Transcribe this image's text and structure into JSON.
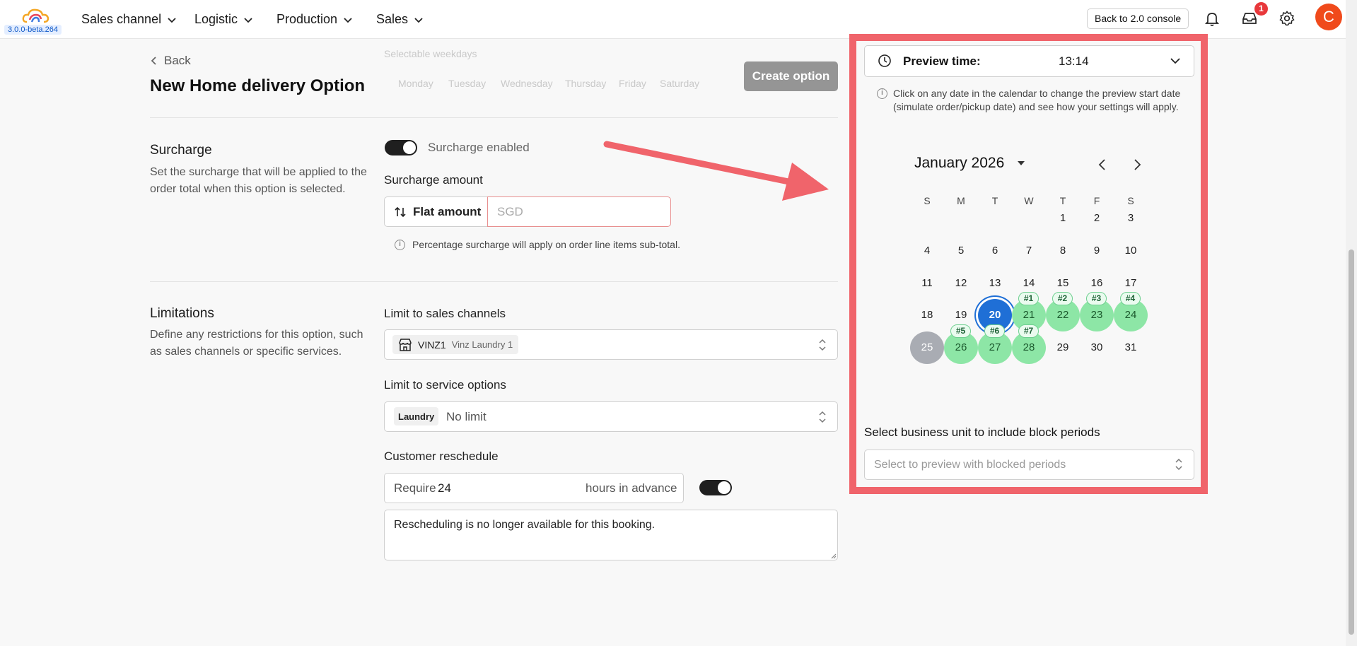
{
  "app": {
    "version": "3.0.0-beta.264",
    "back_console_label": "Back to 2.0 console",
    "notification_count": "1",
    "avatar_initial": "C"
  },
  "nav": {
    "items": [
      {
        "label": "Sales channel"
      },
      {
        "label": "Logistic"
      },
      {
        "label": "Production"
      },
      {
        "label": "Sales"
      }
    ]
  },
  "header": {
    "back_label": "Back",
    "title": "New Home delivery Option",
    "create_label": "Create option"
  },
  "ghost": {
    "selectable_weekdays": "Selectable weekdays",
    "weekdays": [
      "Monday",
      "Tuesday",
      "Wednesday",
      "Thursday",
      "Friday",
      "Saturday"
    ]
  },
  "surcharge": {
    "title": "Surcharge",
    "description": "Set the surcharge that will be applied to the order total when this option is selected.",
    "toggle_label": "Surcharge enabled",
    "toggle_on": true,
    "amount_label": "Surcharge amount",
    "type_label": "Flat amount",
    "amount_placeholder": "SGD",
    "note": "Percentage surcharge will apply on order line items sub-total."
  },
  "limitations": {
    "title": "Limitations",
    "description": "Define any restrictions for this option, such as sales channels or specific services.",
    "sales_channels_label": "Limit to sales channels",
    "sales_channel_code": "VINZ1",
    "sales_channel_name": "Vinz Laundry 1",
    "service_options_label": "Limit to service options",
    "service_chip": "Laundry",
    "service_value": "No limit",
    "reschedule_label": "Customer reschedule",
    "require_prefix": "Require",
    "require_hours": "24",
    "require_suffix": "hours in advance",
    "reschedule_toggle_on": true,
    "reschedule_message": "Rescheduling is no longer available for this booking."
  },
  "preview": {
    "label": "Preview time:",
    "time": "13:14",
    "help": "Click on any date in the calendar to change the preview start date (simulate order/pickup date) and see how your settings will apply.",
    "month": "January 2026",
    "dow": [
      "S",
      "M",
      "T",
      "W",
      "T",
      "F",
      "S"
    ],
    "first_weekday": 4,
    "days_in_month": 31,
    "today": 20,
    "greyed_day": 25,
    "slots": [
      {
        "day": 21,
        "tag": "#1"
      },
      {
        "day": 22,
        "tag": "#2"
      },
      {
        "day": 23,
        "tag": "#3"
      },
      {
        "day": 24,
        "tag": "#4"
      },
      {
        "day": 26,
        "tag": "#5"
      },
      {
        "day": 27,
        "tag": "#6"
      },
      {
        "day": 28,
        "tag": "#7"
      }
    ],
    "bu_label": "Select business unit to include block periods",
    "bu_placeholder": "Select to preview with blocked periods"
  },
  "colors": {
    "annotation": "#f0646b",
    "today": "#1f6fd6",
    "available": "#8de6a6"
  }
}
